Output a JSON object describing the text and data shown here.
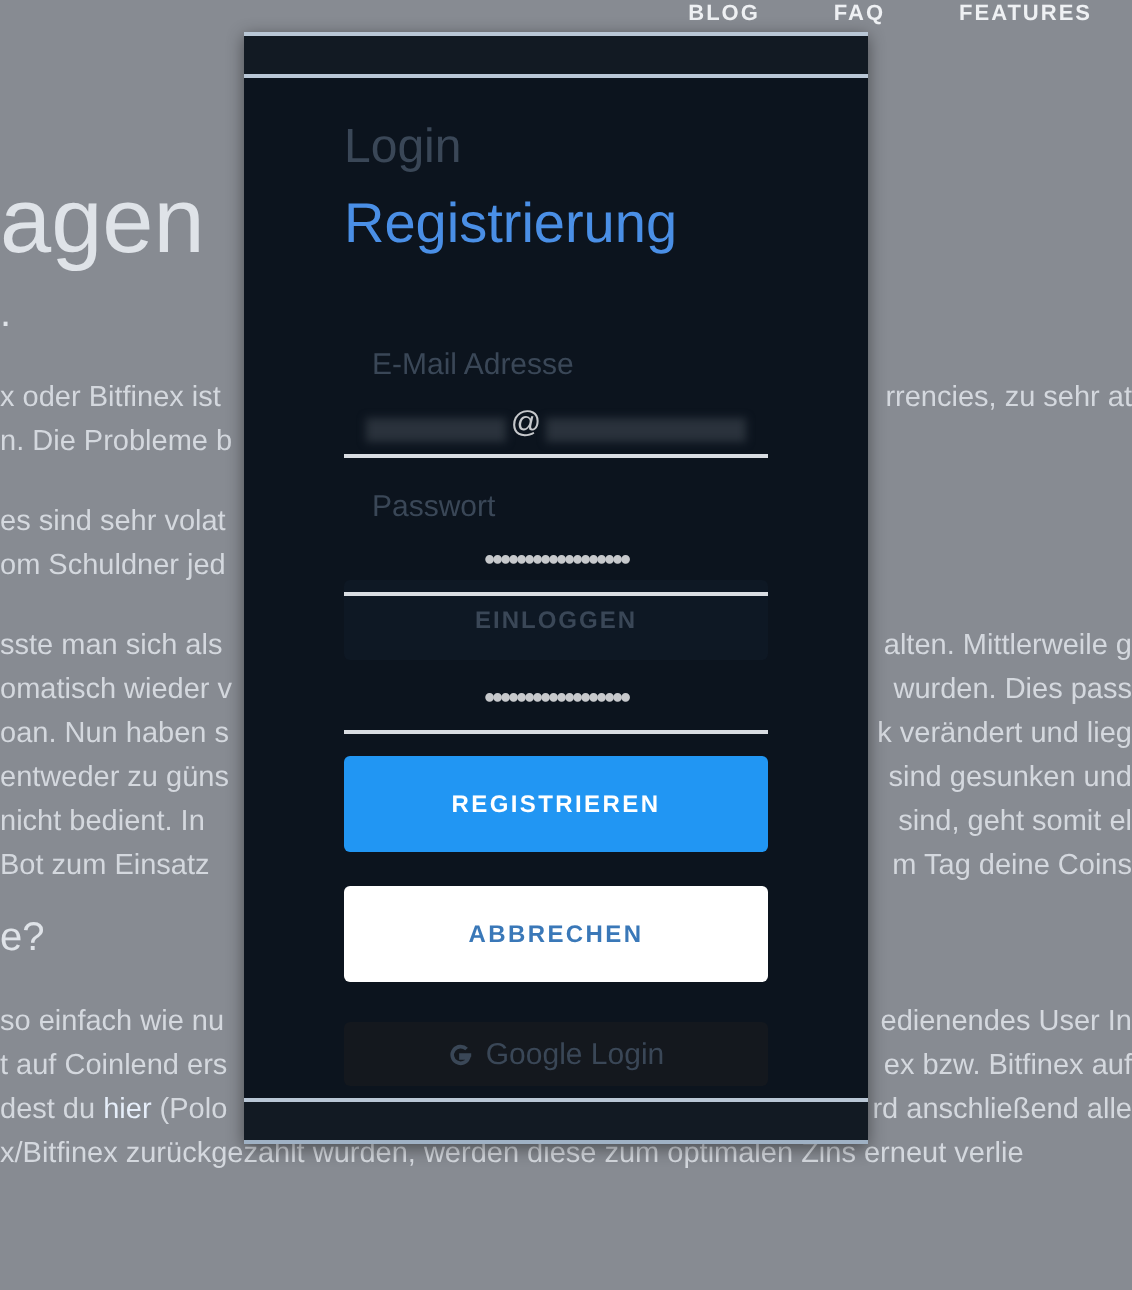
{
  "nav": [
    "BLOG",
    "FAQ",
    "FEATURES"
  ],
  "page": [
    {
      "kind": "heading1",
      "lines": [
        {
          "left": "agen"
        }
      ]
    },
    {
      "kind": "heading2",
      "lines": [
        {
          "left": "."
        }
      ]
    },
    {
      "kind": "paragraph",
      "lines": [
        {
          "left": "x oder Bitfinex ist",
          "right": "rrencies, zu sehr at"
        },
        {
          "left": "n. Die Probleme b"
        }
      ]
    },
    {
      "kind": "paragraph",
      "lines": [
        {
          "left": "es sind sehr volat"
        },
        {
          "left": "om Schuldner jed"
        }
      ]
    },
    {
      "kind": "paragraph",
      "lines": [
        {
          "left": "sste man sich als",
          "right": "alten. Mittlerweile g"
        },
        {
          "left": "omatisch wieder v",
          "right": "wurden. Dies pass"
        },
        {
          "left": "oan. Nun haben s",
          "right": "k verändert und lieg"
        },
        {
          "left": "entweder zu güns",
          "right": "sind gesunken und"
        },
        {
          "left": "nicht bedient. In",
          "right": "sind, geht somit el"
        },
        {
          "left": "Bot zum Einsatz",
          "right": "m Tag deine Coins"
        }
      ]
    },
    {
      "kind": "heading2",
      "lines": [
        {
          "left": "e?"
        }
      ]
    },
    {
      "kind": "paragraph",
      "lines": [
        {
          "left": "so einfach wie nu",
          "right": "edienendes User In"
        },
        {
          "left": "t auf Coinlend ers",
          "right": "ex bzw. Bitfinex auf"
        },
        {
          "segments": [
            {
              "text": "dest du ",
              "link": false
            },
            {
              "text": "hier",
              "link": true
            },
            {
              "text": " (Polo",
              "link": false
            }
          ],
          "right": "rd anschließend alle"
        },
        {
          "left": "x/Bitfinex zurückgezahlt wurden, werden diese zum optimalen Zins erneut verlie"
        }
      ]
    }
  ],
  "login_ghost": {
    "title": "Login",
    "email_label": "E-Mail Adresse",
    "password_label": "Passwort",
    "login_button": "EINLOGGEN",
    "google_button": "Google Login"
  },
  "register": {
    "title": "Registrierung",
    "fields": [
      {
        "kind": "email",
        "value": "@"
      },
      {
        "kind": "password",
        "value": "••••••••••••••••••"
      },
      {
        "kind": "password",
        "value": "••••••••••••••••••"
      }
    ],
    "buttons": [
      {
        "label": "REGISTRIEREN",
        "kind": "primary"
      },
      {
        "label": "ABBRECHEN",
        "kind": "secondary"
      }
    ]
  }
}
